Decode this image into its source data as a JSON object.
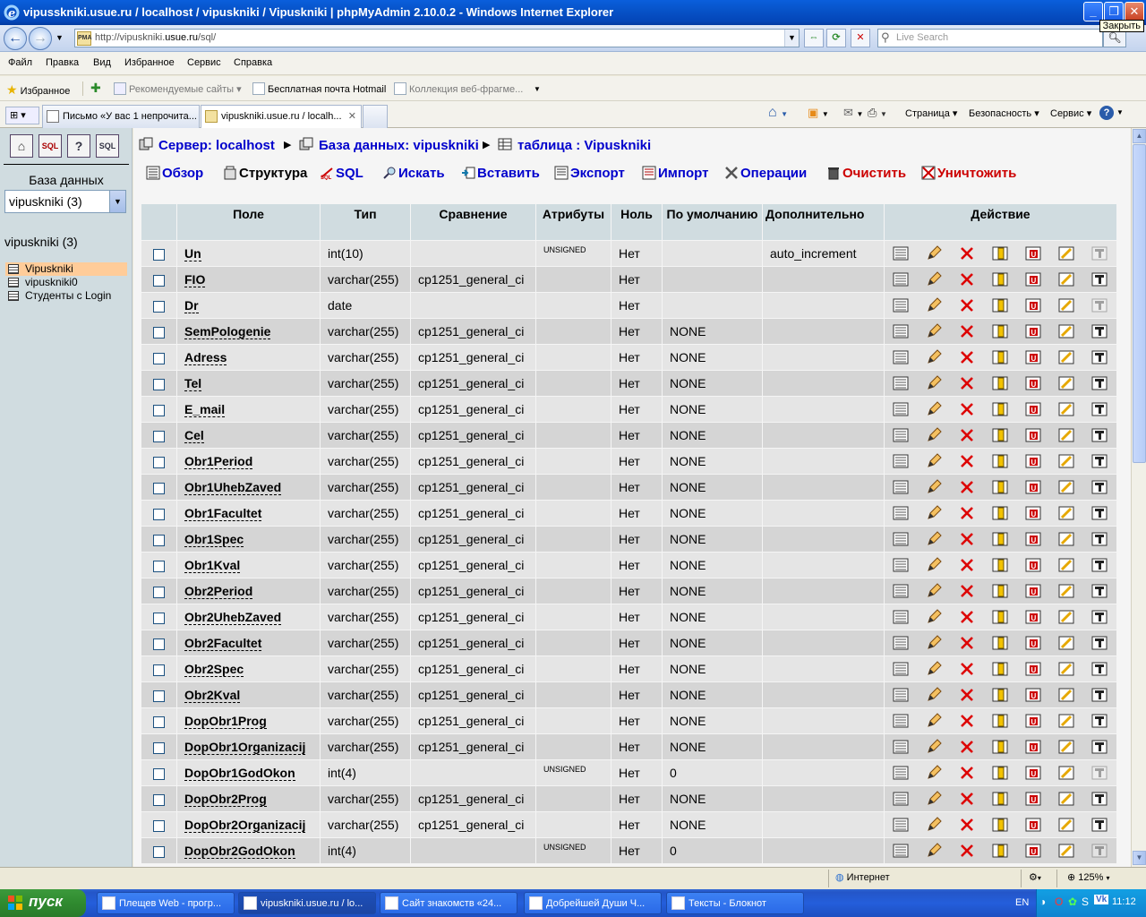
{
  "window": {
    "title": "vipusskniki.usue.ru / localhost / vipuskniki / Vipuskniki | phpMyAdmin 2.10.0.2 - Windows Internet Explorer",
    "close_tooltip": "Закрыть"
  },
  "address": {
    "url_prefix": "http://vipuskniki.",
    "url_domain": "usue.ru",
    "url_suffix": "/sql/",
    "search_placeholder": "Live Search"
  },
  "menu": [
    "Файл",
    "Правка",
    "Вид",
    "Избранное",
    "Сервис",
    "Справка"
  ],
  "favorites": {
    "favorites_label": "Избранное",
    "items": [
      "Рекомендуемые сайты ▾",
      "Бесплатная почта Hotmail",
      "Коллекция веб-фрагме..."
    ]
  },
  "tabs": {
    "items": [
      "Письмо «У вас 1 непрочита...",
      "vipuskniki.usue.ru / localh..."
    ],
    "commands": [
      "Страница ▾",
      "Безопасность ▾",
      "Сервис ▾"
    ]
  },
  "left": {
    "db_label": "База данных",
    "db_select": "vipuskniki (3)",
    "db_name": "vipuskniki (3)",
    "tables": [
      "Vipuskniki",
      "vipuskniki0",
      "Студенты с Login"
    ]
  },
  "breadcrumb": {
    "server": "Сервер: localhost",
    "database": "База данных: vipuskniki",
    "table": "таблица : Vipuskniki"
  },
  "page_tabs": [
    "Обзор",
    "Структура",
    "SQL",
    "Искать",
    "Вставить",
    "Экспорт",
    "Импорт",
    "Операции",
    "Очистить",
    "Уничтожить"
  ],
  "table": {
    "headers": [
      "Поле",
      "Тип",
      "Сравнение",
      "Атрибуты",
      "Ноль",
      "По умолчанию",
      "Дополнительно",
      "Действие"
    ],
    "rows": [
      {
        "field": "Un",
        "type": "int(10)",
        "collation": "",
        "attr": "UNSIGNED",
        "null": "Нет",
        "default": "",
        "extra": "auto_increment"
      },
      {
        "field": "FIO",
        "type": "varchar(255)",
        "collation": "cp1251_general_ci",
        "attr": "",
        "null": "Нет",
        "default": "",
        "extra": ""
      },
      {
        "field": "Dr",
        "type": "date",
        "collation": "",
        "attr": "",
        "null": "Нет",
        "default": "",
        "extra": ""
      },
      {
        "field": "SemPologenie",
        "type": "varchar(255)",
        "collation": "cp1251_general_ci",
        "attr": "",
        "null": "Нет",
        "default": "NONE",
        "extra": ""
      },
      {
        "field": "Adress",
        "type": "varchar(255)",
        "collation": "cp1251_general_ci",
        "attr": "",
        "null": "Нет",
        "default": "NONE",
        "extra": ""
      },
      {
        "field": "Tel",
        "type": "varchar(255)",
        "collation": "cp1251_general_ci",
        "attr": "",
        "null": "Нет",
        "default": "NONE",
        "extra": ""
      },
      {
        "field": "E_mail",
        "type": "varchar(255)",
        "collation": "cp1251_general_ci",
        "attr": "",
        "null": "Нет",
        "default": "NONE",
        "extra": ""
      },
      {
        "field": "Cel",
        "type": "varchar(255)",
        "collation": "cp1251_general_ci",
        "attr": "",
        "null": "Нет",
        "default": "NONE",
        "extra": ""
      },
      {
        "field": "Obr1Period",
        "type": "varchar(255)",
        "collation": "cp1251_general_ci",
        "attr": "",
        "null": "Нет",
        "default": "NONE",
        "extra": ""
      },
      {
        "field": "Obr1UhebZaved",
        "type": "varchar(255)",
        "collation": "cp1251_general_ci",
        "attr": "",
        "null": "Нет",
        "default": "NONE",
        "extra": ""
      },
      {
        "field": "Obr1Facultet",
        "type": "varchar(255)",
        "collation": "cp1251_general_ci",
        "attr": "",
        "null": "Нет",
        "default": "NONE",
        "extra": ""
      },
      {
        "field": "Obr1Spec",
        "type": "varchar(255)",
        "collation": "cp1251_general_ci",
        "attr": "",
        "null": "Нет",
        "default": "NONE",
        "extra": ""
      },
      {
        "field": "Obr1Kval",
        "type": "varchar(255)",
        "collation": "cp1251_general_ci",
        "attr": "",
        "null": "Нет",
        "default": "NONE",
        "extra": ""
      },
      {
        "field": "Obr2Period",
        "type": "varchar(255)",
        "collation": "cp1251_general_ci",
        "attr": "",
        "null": "Нет",
        "default": "NONE",
        "extra": ""
      },
      {
        "field": "Obr2UhebZaved",
        "type": "varchar(255)",
        "collation": "cp1251_general_ci",
        "attr": "",
        "null": "Нет",
        "default": "NONE",
        "extra": ""
      },
      {
        "field": "Obr2Facultet",
        "type": "varchar(255)",
        "collation": "cp1251_general_ci",
        "attr": "",
        "null": "Нет",
        "default": "NONE",
        "extra": ""
      },
      {
        "field": "Obr2Spec",
        "type": "varchar(255)",
        "collation": "cp1251_general_ci",
        "attr": "",
        "null": "Нет",
        "default": "NONE",
        "extra": ""
      },
      {
        "field": "Obr2Kval",
        "type": "varchar(255)",
        "collation": "cp1251_general_ci",
        "attr": "",
        "null": "Нет",
        "default": "NONE",
        "extra": ""
      },
      {
        "field": "DopObr1Prog",
        "type": "varchar(255)",
        "collation": "cp1251_general_ci",
        "attr": "",
        "null": "Нет",
        "default": "NONE",
        "extra": ""
      },
      {
        "field": "DopObr1Organizacij",
        "type": "varchar(255)",
        "collation": "cp1251_general_ci",
        "attr": "",
        "null": "Нет",
        "default": "NONE",
        "extra": ""
      },
      {
        "field": "DopObr1GodOkon",
        "type": "int(4)",
        "collation": "",
        "attr": "UNSIGNED",
        "null": "Нет",
        "default": "0",
        "extra": ""
      },
      {
        "field": "DopObr2Prog",
        "type": "varchar(255)",
        "collation": "cp1251_general_ci",
        "attr": "",
        "null": "Нет",
        "default": "NONE",
        "extra": ""
      },
      {
        "field": "DopObr2Organizacij",
        "type": "varchar(255)",
        "collation": "cp1251_general_ci",
        "attr": "",
        "null": "Нет",
        "default": "NONE",
        "extra": ""
      },
      {
        "field": "DopObr2GodOkon",
        "type": "int(4)",
        "collation": "",
        "attr": "UNSIGNED",
        "null": "Нет",
        "default": "0",
        "extra": ""
      }
    ],
    "action_icons": [
      "browse-distinct-icon",
      "edit-icon",
      "drop-icon",
      "primary-key-icon",
      "unique-icon",
      "index-icon",
      "fulltext-icon"
    ]
  },
  "status": {
    "zone": "Интернет",
    "zoom": "125%"
  },
  "taskbar": {
    "start": "пуск",
    "tasks": [
      "Плещев Web - прогр...",
      "vipuskniki.usue.ru / lo...",
      "Сайт знакомств «24...",
      "Добрейшей Души Ч...",
      "Тексты - Блокнот"
    ],
    "lang": "EN",
    "clock": "11:12"
  },
  "colors": {
    "link": "#0000cc",
    "danger": "#cc0000",
    "header_bg": "#d0dce0",
    "row_odd": "#e5e5e5",
    "row_even": "#d5d5d5",
    "selected_table": "#ffcc99"
  }
}
